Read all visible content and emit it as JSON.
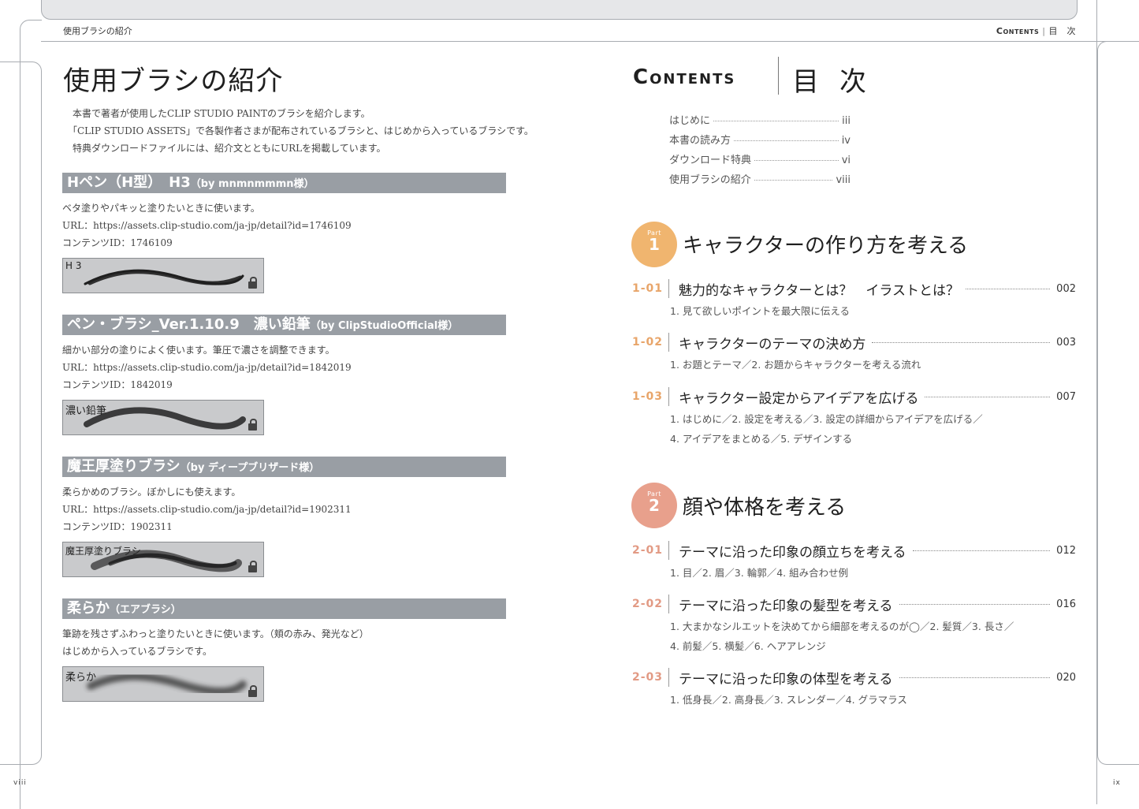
{
  "header": {
    "left": "使用ブラシの紹介",
    "right_en": "Contents",
    "right_sep": "|",
    "right_jp": "目　次"
  },
  "left_page": {
    "title": "使用ブラシの紹介",
    "intro": [
      "本書で著者が使用したCLIP STUDIO PAINTのブラシを紹介します。",
      "「CLIP STUDIO ASSETS」で各製作者さまが配布されているブラシと、はじめから入っているブラシです。",
      "特典ダウンロードファイルには、紹介文とともにURLを掲載しています。"
    ],
    "brushes": [
      {
        "name": "Hペン（H型）　H3",
        "author": "（by mnmnmmmn様）",
        "desc": [
          "ベタ塗りやパキッと塗りたいときに使います。",
          "URL：https://assets.clip-studio.com/ja-jp/detail?id=1746109",
          "コンテンツID：1746109"
        ],
        "swatch_label": "H 3"
      },
      {
        "name": "ペン・ブラシ_Ver.1.10.9　濃い鉛筆",
        "author": "（by ClipStudioOfficial様）",
        "desc": [
          "細かい部分の塗りによく使います。筆圧で濃さを調整できます。",
          "URL：https://assets.clip-studio.com/ja-jp/detail?id=1842019",
          "コンテンツID：1842019"
        ],
        "swatch_label": "濃い鉛筆"
      },
      {
        "name": "魔王厚塗りブラシ",
        "author": "（by ディープブリザード様）",
        "desc": [
          "柔らかめのブラシ。ぼかしにも使えます。",
          "URL：https://assets.clip-studio.com/ja-jp/detail?id=1902311",
          "コンテンツID：1902311"
        ],
        "swatch_label": "魔王厚塗りブラシ"
      },
      {
        "name": "柔らか",
        "author": "（エアブラシ）",
        "desc": [
          "筆跡を残さずふわっと塗りたいときに使います。（頬の赤み、発光など）",
          "はじめから入っているブラシです。"
        ],
        "swatch_label": "柔らか"
      }
    ],
    "folio": "viii"
  },
  "right_page": {
    "contents_en": "Contents",
    "contents_jp": "目次",
    "front": [
      {
        "title": "はじめに",
        "page": "iii"
      },
      {
        "title": "本書の読み方",
        "page": "iv"
      },
      {
        "title": "ダウンロード特典",
        "page": "vi"
      },
      {
        "title": "使用ブラシの紹介",
        "page": "viii"
      }
    ],
    "parts": [
      {
        "label": "Part",
        "number": "1",
        "title": "キャラクターの作り方を考える",
        "color": "#f0b56f",
        "chapters": [
          {
            "num": "1-01",
            "title": "魅力的なキャラクターとは？　イラストとは？",
            "page": "002",
            "sub": [
              "1. 見て欲しいポイントを最大限に伝える"
            ]
          },
          {
            "num": "1-02",
            "title": "キャラクターのテーマの決め方",
            "page": "003",
            "sub": [
              "1. お題とテーマ／2. お題からキャラクターを考える流れ"
            ]
          },
          {
            "num": "1-03",
            "title": "キャラクター設定からアイデアを広げる",
            "page": "007",
            "sub": [
              "1. はじめに／2. 設定を考える／3. 設定の詳細からアイデアを広げる／",
              "4. アイデアをまとめる／5. デザインする"
            ]
          }
        ]
      },
      {
        "label": "Part",
        "number": "2",
        "title": "顔や体格を考える",
        "color": "#e8a08c",
        "chapters": [
          {
            "num": "2-01",
            "title": "テーマに沿った印象の顔立ちを考える",
            "page": "012",
            "sub": [
              "1. 目／2. 眉／3. 輪郭／4. 組み合わせ例"
            ]
          },
          {
            "num": "2-02",
            "title": "テーマに沿った印象の髪型を考える",
            "page": "016",
            "sub": [
              "1. 大まかなシルエットを決めてから細部を考えるのが◯／2. 髪質／3. 長さ／",
              "4. 前髪／5. 横髪／6. ヘアアレンジ"
            ]
          },
          {
            "num": "2-03",
            "title": "テーマに沿った印象の体型を考える",
            "page": "020",
            "sub": [
              "1. 低身長／2. 高身長／3. スレンダー／4. グラマラス"
            ]
          }
        ]
      }
    ],
    "folio": "ix"
  }
}
